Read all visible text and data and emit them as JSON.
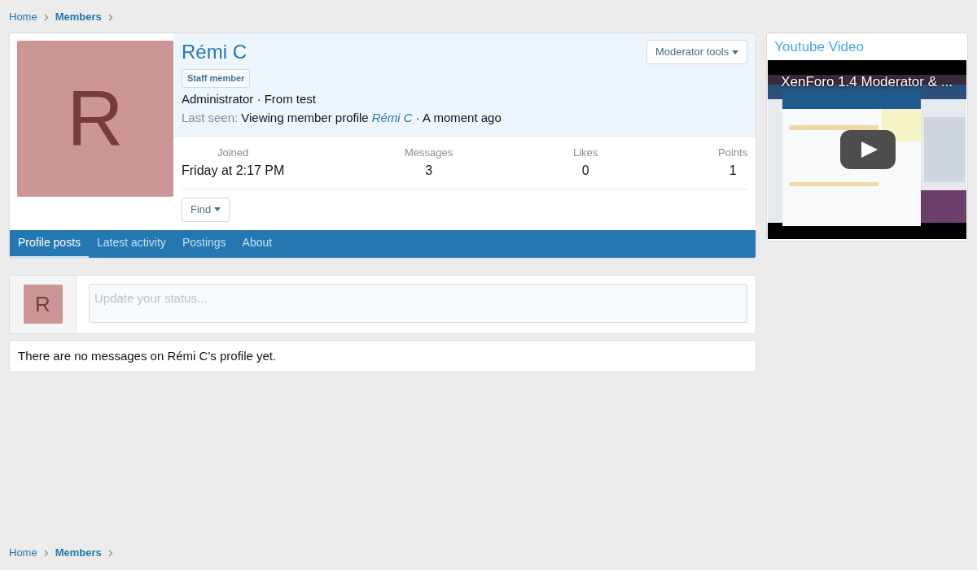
{
  "breadcrumb_top": [
    {
      "label": "Home",
      "current": false
    },
    {
      "label": "Members",
      "current": true
    }
  ],
  "profile": {
    "avatar_letter": "R",
    "name": "Rémi C",
    "badge": "Staff member",
    "info": "Administrator · From test",
    "last_seen_label": "Last seen:",
    "last_seen_activity": "Viewing member profile",
    "last_seen_link": "Rémi C",
    "last_seen_time": "· A moment ago",
    "moderator_button": "Moderator tools",
    "find_button": "Find"
  },
  "stats": [
    {
      "label": "Joined",
      "value": "Friday at 2:17 PM"
    },
    {
      "label": "Messages",
      "value": "3"
    },
    {
      "label": "Likes",
      "value": "0"
    },
    {
      "label": "Points",
      "value": "1"
    }
  ],
  "tabs": [
    {
      "label": "Profile posts",
      "selected": true
    },
    {
      "label": "Latest activity",
      "selected": false
    },
    {
      "label": "Postings",
      "selected": false
    },
    {
      "label": "About",
      "selected": false
    }
  ],
  "status_box": {
    "avatar_letter": "R",
    "placeholder": "Update your status..."
  },
  "empty_message": "There are no messages on Rémi C's profile yet.",
  "sidebar": {
    "title": "Youtube Video",
    "video_title": "XenForo 1.4 Moderator & ..."
  },
  "breadcrumb_bottom": [
    {
      "label": "Home",
      "current": false
    },
    {
      "label": "Members",
      "current": true
    }
  ]
}
